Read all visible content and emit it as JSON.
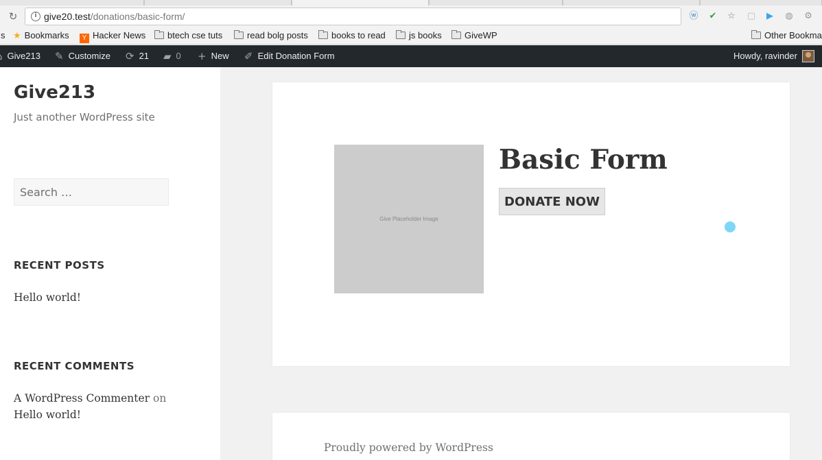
{
  "browser": {
    "url_host": "give20.test",
    "url_path": "/donations/basic-form/",
    "bookmarks": [
      {
        "label": "s",
        "icon": "none"
      },
      {
        "label": "Bookmarks",
        "icon": "star-icon"
      },
      {
        "label": "Hacker News",
        "icon": "ycombinator-icon"
      },
      {
        "label": "btech cse tuts",
        "icon": "folder-icon"
      },
      {
        "label": "read bolg posts",
        "icon": "folder-icon"
      },
      {
        "label": "books to read",
        "icon": "folder-icon"
      },
      {
        "label": "js books",
        "icon": "folder-icon"
      },
      {
        "label": "GiveWP",
        "icon": "folder-icon"
      },
      {
        "label": "Other Bookma",
        "icon": "folder-icon"
      }
    ]
  },
  "admin_bar": {
    "site_name": "Give213",
    "customize": "Customize",
    "updates_count": "21",
    "comments_count": "0",
    "new": "New",
    "edit": "Edit Donation Form",
    "howdy": "Howdy, ravinder"
  },
  "sidebar": {
    "site_title": "Give213",
    "tagline": "Just another WordPress site",
    "search_placeholder": "Search …",
    "recent_posts_title": "RECENT POSTS",
    "recent_posts": [
      "Hello world!"
    ],
    "recent_comments_title": "RECENT COMMENTS",
    "recent_comment": {
      "author": "A WordPress Commenter",
      "on": "on",
      "post": "Hello world!"
    }
  },
  "main": {
    "placeholder_text": "Give Placeholder Image",
    "form_title": "Basic Form",
    "donate_button": "DONATE NOW",
    "footer_text": "Proudly powered by WordPress"
  },
  "colors": {
    "admin_bar_bg": "#23282d",
    "page_bg": "#f1f1f1",
    "cursor_highlight": "#7fd6f7"
  }
}
